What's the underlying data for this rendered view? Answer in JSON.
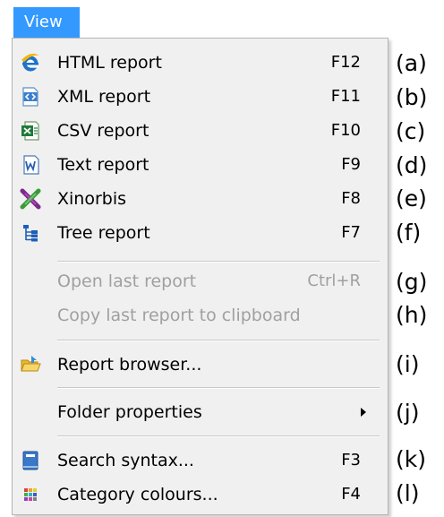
{
  "menu": {
    "title": "View"
  },
  "items": {
    "html": {
      "label": "HTML report",
      "shortcut": "F12",
      "icon": "internet-explorer-icon"
    },
    "xml": {
      "label": "XML report",
      "shortcut": "F11",
      "icon": "xml-document-icon"
    },
    "csv": {
      "label": "CSV report",
      "shortcut": "F10",
      "icon": "excel-document-icon"
    },
    "text": {
      "label": "Text report",
      "shortcut": "F9",
      "icon": "word-document-icon"
    },
    "xinorbis": {
      "label": "Xinorbis",
      "shortcut": "F8",
      "icon": "xinorbis-icon"
    },
    "tree": {
      "label": "Tree report",
      "shortcut": "F7",
      "icon": "tree-icon"
    },
    "open_last": {
      "label": "Open last report",
      "shortcut": "Ctrl+R"
    },
    "copy_last": {
      "label": "Copy last report to clipboard"
    },
    "browser": {
      "label": "Report browser...",
      "icon": "folder-open-icon"
    },
    "folder_props": {
      "label": "Folder properties"
    },
    "search_syntax": {
      "label": "Search syntax...",
      "shortcut": "F3",
      "icon": "book-icon"
    },
    "category_colours": {
      "label": "Category colours...",
      "shortcut": "F4",
      "icon": "color-grid-icon"
    }
  },
  "annotations": [
    "(a)",
    "(b)",
    "(c)",
    "(d)",
    "(e)",
    "(f)",
    "(g)",
    "(h)",
    "(i)",
    "(j)",
    "(k)",
    "(l)"
  ],
  "colors": {
    "highlight": "#3399ff",
    "menu_background": "#f0f0f0",
    "disabled_text": "#a0a0a0"
  }
}
